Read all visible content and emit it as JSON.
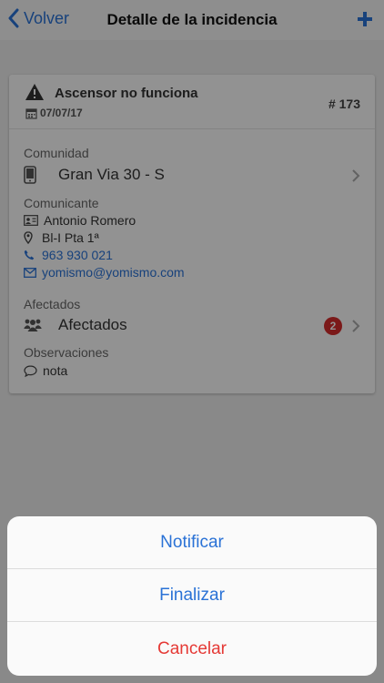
{
  "nav": {
    "back_label": "Volver",
    "title": "Detalle de la incidencia"
  },
  "incidence": {
    "title": "Ascensor no funciona",
    "date": "07/07/17",
    "number": "# 173"
  },
  "comunidad": {
    "label": "Comunidad",
    "value": "Gran Via 30 - S"
  },
  "comunicante": {
    "label": "Comunicante",
    "name": "Antonio Romero",
    "location": "Bl-I Pta 1ª",
    "phone": "963 930 021",
    "email": "yomismo@yomismo.com"
  },
  "afectados": {
    "label": "Afectados",
    "value": "Afectados",
    "count": "2"
  },
  "observaciones": {
    "label": "Observaciones",
    "value": "nota"
  },
  "action_sheet": {
    "notify": "Notificar",
    "finish": "Finalizar",
    "cancel": "Cancelar"
  },
  "colors": {
    "accent": "#2a72d6",
    "danger": "#e53935",
    "badge": "#d42c2c"
  }
}
